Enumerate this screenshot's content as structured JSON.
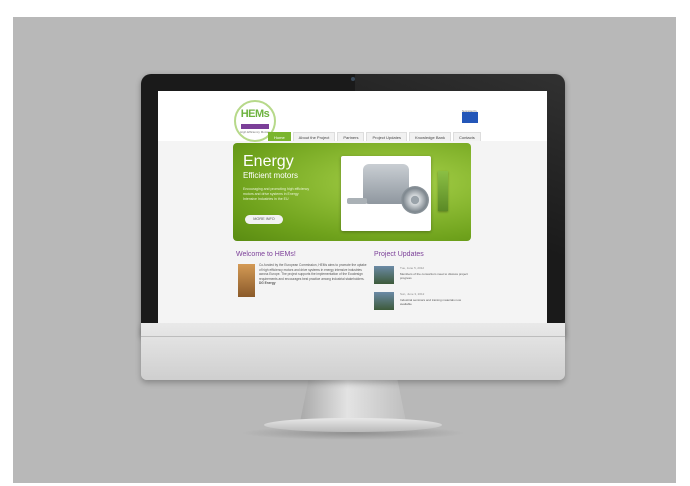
{
  "site": {
    "logo": {
      "text": "HEMs",
      "sub": "High Efficiency Motors"
    },
    "eu_caption": "Supported by",
    "nav": [
      {
        "label": "Home",
        "active": true
      },
      {
        "label": "About the Project",
        "active": false
      },
      {
        "label": "Partners",
        "active": false
      },
      {
        "label": "Project Updates",
        "active": false
      },
      {
        "label": "Knowledge Bank",
        "active": false
      },
      {
        "label": "Contacts",
        "active": false
      }
    ],
    "hero": {
      "title": "Energy",
      "subtitle": "Efficient motors",
      "text": "Encouraging and promoting high efficiency motors and drive systems in Energy Intensive Industries in the EU",
      "button": "MORE INFO"
    },
    "welcome": {
      "title": "Welcome to HEMs!",
      "text": "Co-funded by the European Commission, HEMs aims to promote the uptake of high efficiency motors and drive systems in energy intensive industries across Europe. The project supports the implementation of the Ecodesign requirements and encourages best practice among industrial stakeholders.",
      "strong": "DG Energy"
    },
    "updates": {
      "title": "Project Updates",
      "items": [
        {
          "date": "Tue, June 5, 2012",
          "text": "Members of the consortium meet to discuss project progress"
        },
        {
          "date": "Sun, June 3, 2012",
          "text": "Industrial seminars and training materials now available"
        }
      ]
    }
  },
  "colors": {
    "accent_green": "#7ab52d",
    "purple": "#7b3f98",
    "frame": "#1a1a1a",
    "stage": "#b8b8b8"
  }
}
